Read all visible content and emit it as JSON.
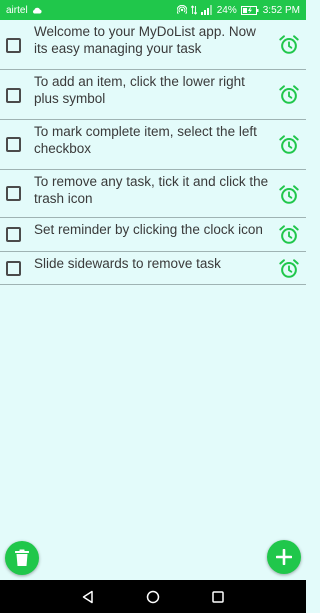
{
  "status_bar": {
    "carrier": "airtel",
    "battery_percent": "24%",
    "time": "3:52 PM"
  },
  "tasks": [
    {
      "text": "Welcome to your MyDoList app. Now its easy managing your task",
      "checked": false
    },
    {
      "text": "To add an item, click the lower right plus symbol",
      "checked": false
    },
    {
      "text": "To mark complete item, select the left checkbox",
      "checked": false
    },
    {
      "text": "To remove any task, tick it and click the trash icon",
      "checked": false
    },
    {
      "text": "Set reminder by clicking the clock icon",
      "checked": false
    },
    {
      "text": "Slide sidewards to remove task",
      "checked": false
    }
  ],
  "colors": {
    "accent": "#20C74B",
    "background": "#E3FBFA",
    "divider": "#9fb3b3",
    "text": "#3a3a3a"
  },
  "icons": {
    "reminder": "alarm-clock-icon",
    "delete": "trash-icon",
    "add": "plus-icon",
    "nav_back": "back-triangle-icon",
    "nav_home": "home-circle-icon",
    "nav_recents": "recents-square-icon"
  }
}
